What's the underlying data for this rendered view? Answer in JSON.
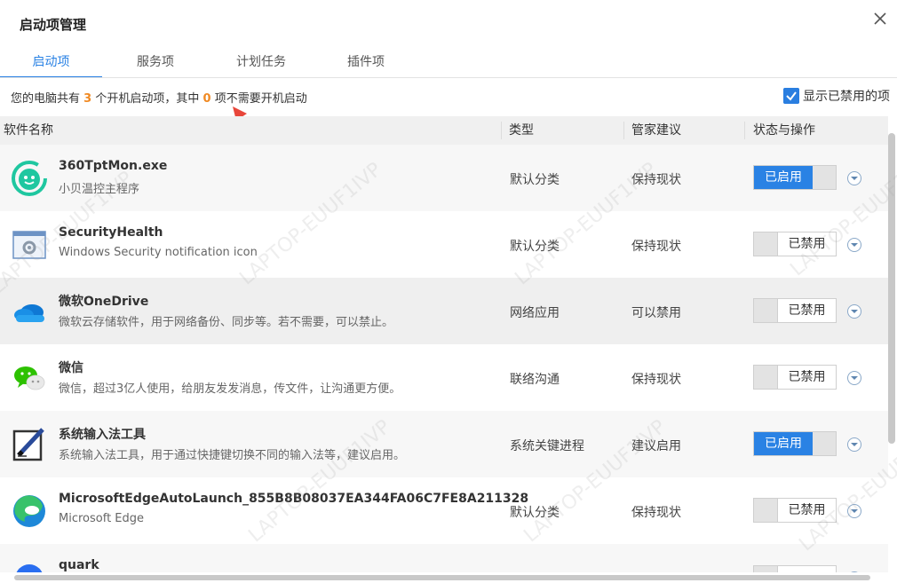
{
  "window": {
    "title": "启动项管理"
  },
  "tabs": [
    {
      "label": "启动项",
      "active": true
    },
    {
      "label": "服务项",
      "active": false
    },
    {
      "label": "计划任务",
      "active": false
    },
    {
      "label": "插件项",
      "active": false
    }
  ],
  "info": {
    "prefix": "您的电脑共有",
    "total": "3",
    "middle": "个开机启动项，其中",
    "unneeded": "0",
    "suffix": "项不需要开机启动"
  },
  "show_disabled": {
    "label": "显示已禁用的项",
    "checked": true
  },
  "columns": {
    "name": "软件名称",
    "type": "类型",
    "advice": "管家建议",
    "status": "状态与操作"
  },
  "rows": [
    {
      "name": "360TptMon.exe",
      "desc": "小贝温控主程序",
      "type": "默认分类",
      "advice": "保持现状",
      "status": "已启用",
      "enabled": true,
      "icon": "smiley-icon"
    },
    {
      "name": "SecurityHealth",
      "desc": "Windows Security notification icon",
      "type": "默认分类",
      "advice": "保持现状",
      "status": "已禁用",
      "enabled": false,
      "icon": "settings-window-icon"
    },
    {
      "name": "微软OneDrive",
      "desc": "微软云存储软件，用于网络备份、同步等。若不需要，可以禁止。",
      "type": "网络应用",
      "advice": "可以禁用",
      "status": "已禁用",
      "enabled": false,
      "icon": "onedrive-cloud-icon"
    },
    {
      "name": "微信",
      "desc": "微信，超过3亿人使用，给朋友发发消息，传文件，让沟通更方便。",
      "type": "联络沟通",
      "advice": "保持现状",
      "status": "已禁用",
      "enabled": false,
      "icon": "wechat-icon"
    },
    {
      "name": "系统输入法工具",
      "desc": "系统输入法工具，用于通过快捷键切换不同的输入法等，建议启用。",
      "type": "系统关键进程",
      "advice": "建议启用",
      "status": "已启用",
      "enabled": true,
      "icon": "pen-pad-icon"
    },
    {
      "name": "MicrosoftEdgeAutoLaunch_855B8B08037EA344FA06C7FE8A211328",
      "desc": "Microsoft Edge",
      "type": "默认分类",
      "advice": "保持现状",
      "status": "已禁用",
      "enabled": false,
      "icon": "edge-icon"
    },
    {
      "name": "quark",
      "desc": "",
      "type": "",
      "advice": "",
      "status": "",
      "enabled": false,
      "icon": "quark-icon"
    }
  ],
  "watermark": "LAPTOP-EUUF1IVP",
  "colors": {
    "accent": "#2a82e4",
    "highlight": "#f08a24"
  }
}
